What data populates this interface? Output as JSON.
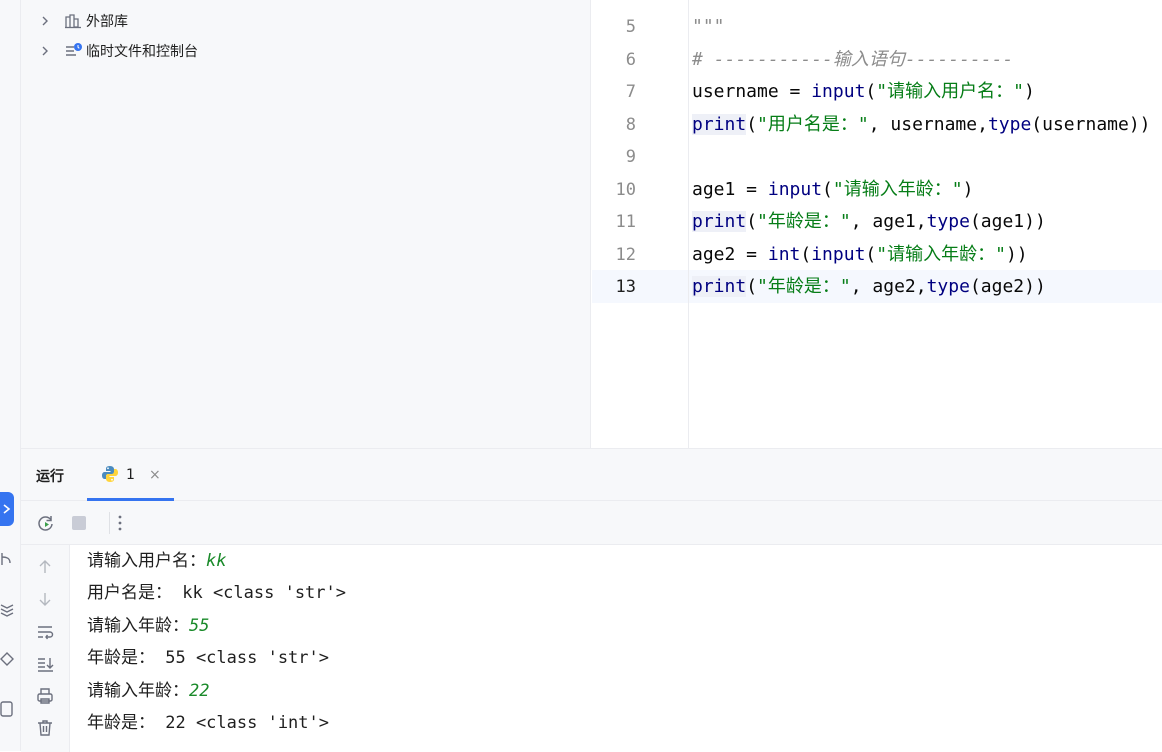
{
  "project_tree": {
    "items": [
      {
        "label": "外部库",
        "icon": "library-icon"
      },
      {
        "label": "临时文件和控制台",
        "icon": "scratches-icon"
      }
    ]
  },
  "editor": {
    "line_numbers": [
      "5",
      "6",
      "7",
      "8",
      "9",
      "10",
      "11",
      "12",
      "13"
    ],
    "current_line": "13",
    "lines": {
      "l5": {
        "doc": "\"\"\""
      },
      "l6": {
        "comment": "# -----------输入语句----------"
      },
      "l7": {
        "a": "username = ",
        "fn": "input",
        "b": "(",
        "s": "\"请输入用户名：\"",
        "c": ")"
      },
      "l8": {
        "kw": "print",
        "a": "(",
        "s": "\"用户名是：\"",
        "b": ", username,",
        "fn": "type",
        "c": "(username))"
      },
      "l10": {
        "a": "age1 = ",
        "fn": "input",
        "b": "(",
        "s": "\"请输入年龄：\"",
        "c": ")"
      },
      "l11": {
        "kw": "print",
        "a": "(",
        "s": "\"年龄是：\"",
        "b": ", age1,",
        "fn": "type",
        "c": "(age1))"
      },
      "l12": {
        "a": "age2 = ",
        "fn1": "int",
        "b": "(",
        "fn2": "input",
        "c": "(",
        "s": "\"请输入年龄：\"",
        "d": "))"
      },
      "l13": {
        "kw": "print",
        "a": "(",
        "s": "\"年龄是：\"",
        "b": ", age2,",
        "fn": "type",
        "c": "(age2))"
      }
    }
  },
  "run_panel": {
    "title": "运行",
    "tab_label": "1",
    "tab_close": "×",
    "console": [
      {
        "text": "请输入用户名：",
        "input": "kk"
      },
      {
        "text": "用户名是： kk <class 'str'>"
      },
      {
        "text": "请输入年龄：",
        "input": "55"
      },
      {
        "text": "年龄是： 55 <class 'str'>"
      },
      {
        "text": "请输入年龄：",
        "input": "22"
      },
      {
        "text": "年龄是： 22 <class 'int'>"
      }
    ]
  },
  "colors": {
    "accent": "#3574f0",
    "string": "#067d17",
    "keyword": "#000080",
    "user_input": "#1a8a2a"
  }
}
